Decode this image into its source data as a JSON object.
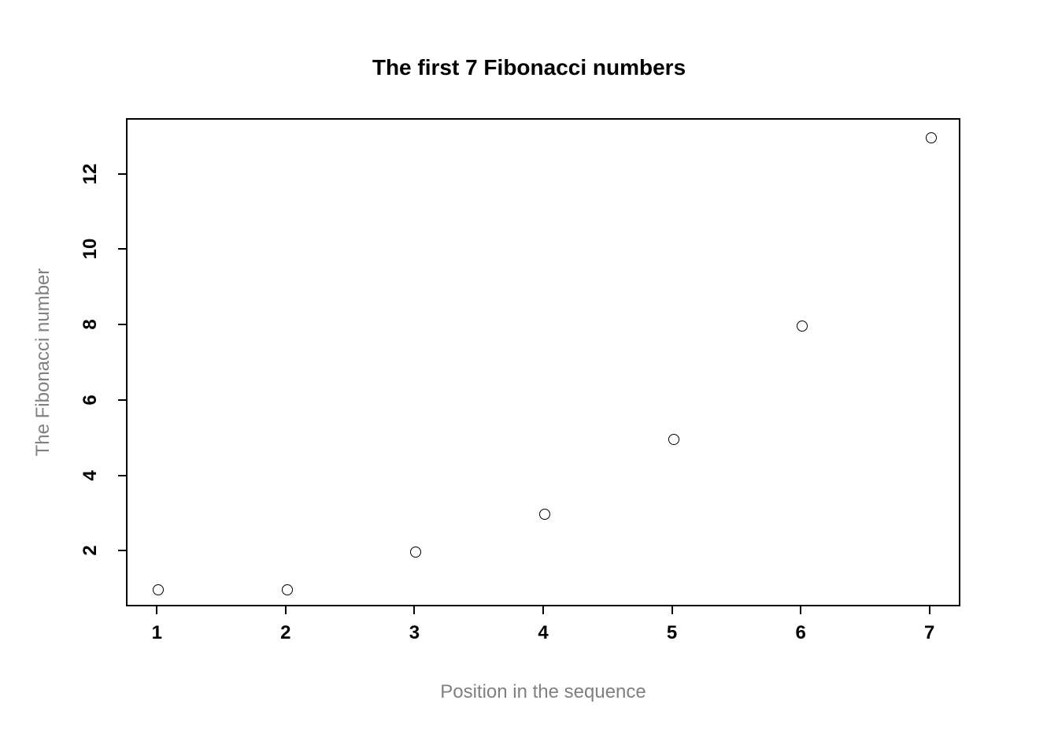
{
  "chart_data": {
    "type": "scatter",
    "title": "The first 7 Fibonacci numbers",
    "xlabel": "Position in the sequence",
    "ylabel": "The Fibonacci number",
    "x": [
      1,
      2,
      3,
      4,
      5,
      6,
      7
    ],
    "y": [
      1,
      1,
      2,
      3,
      5,
      8,
      13
    ],
    "xticks": [
      1,
      2,
      3,
      4,
      5,
      6,
      7
    ],
    "yticks": [
      2,
      4,
      6,
      8,
      10,
      12
    ],
    "xlim": [
      0.76,
      7.24
    ],
    "ylim": [
      0.52,
      13.48
    ]
  }
}
